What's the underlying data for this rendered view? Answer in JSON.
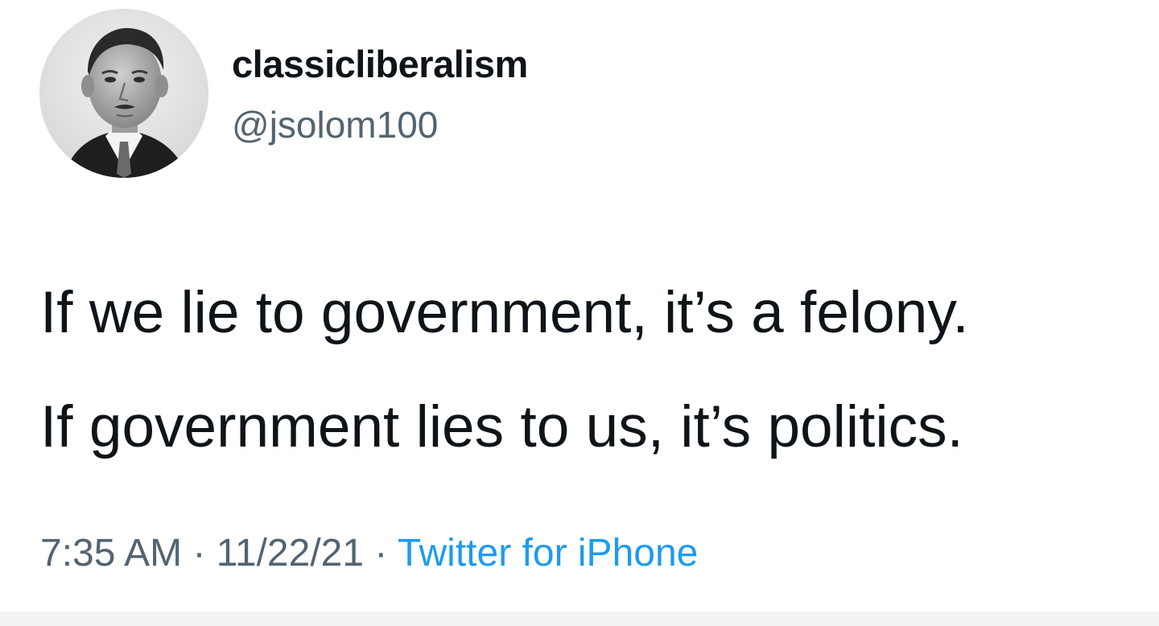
{
  "user": {
    "display_name": "classicliberalism",
    "handle": "@jsolom100",
    "avatar_icon": "user-avatar-icon"
  },
  "tweet": {
    "lines": [
      "If we lie to government, it’s a felony.",
      "If government lies to us, it’s politics."
    ]
  },
  "meta": {
    "time": "7:35 AM",
    "separator": " · ",
    "date": "11/22/21",
    "source": "Twitter for iPhone"
  },
  "colors": {
    "text": "#0f1419",
    "secondary": "#536471",
    "link": "#1d9bf0"
  }
}
